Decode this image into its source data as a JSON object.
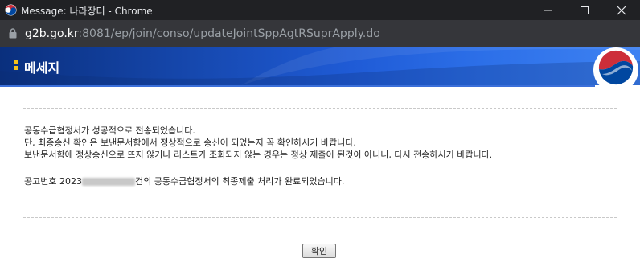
{
  "window": {
    "title": "Message: 나라장터 - Chrome",
    "controls": [
      "minimize-icon",
      "maximize-icon",
      "close-icon"
    ]
  },
  "address_bar": {
    "host": "g2b.go.kr",
    "path": ":8081/ep/join/conso/updateJointSppAgtRSuprApply.do"
  },
  "header": {
    "title": "메세지",
    "accent_color": "#f7c21a",
    "band_color": "#1f5bd6"
  },
  "message": {
    "line1": "공동수급협정서가 성공적으로 전송되었습니다.",
    "line2": "단, 최종송신 확인은 보낸문서함에서 정상적으로 송신이 되었는지 꼭 확인하시기 바랍니다.",
    "line3": "보낸문서함에 정상송신으로 뜨지 않거나 리스트가 조회되지 않는 경우는 정상 제출이 된것이 아니니, 다시 전송하시기 바랍니다.",
    "notice_prefix": "공고번호 2023",
    "notice_suffix": "건의 공동수급협정서의 최종제출 처리가 완료되었습니다."
  },
  "buttons": {
    "confirm": "확인"
  }
}
